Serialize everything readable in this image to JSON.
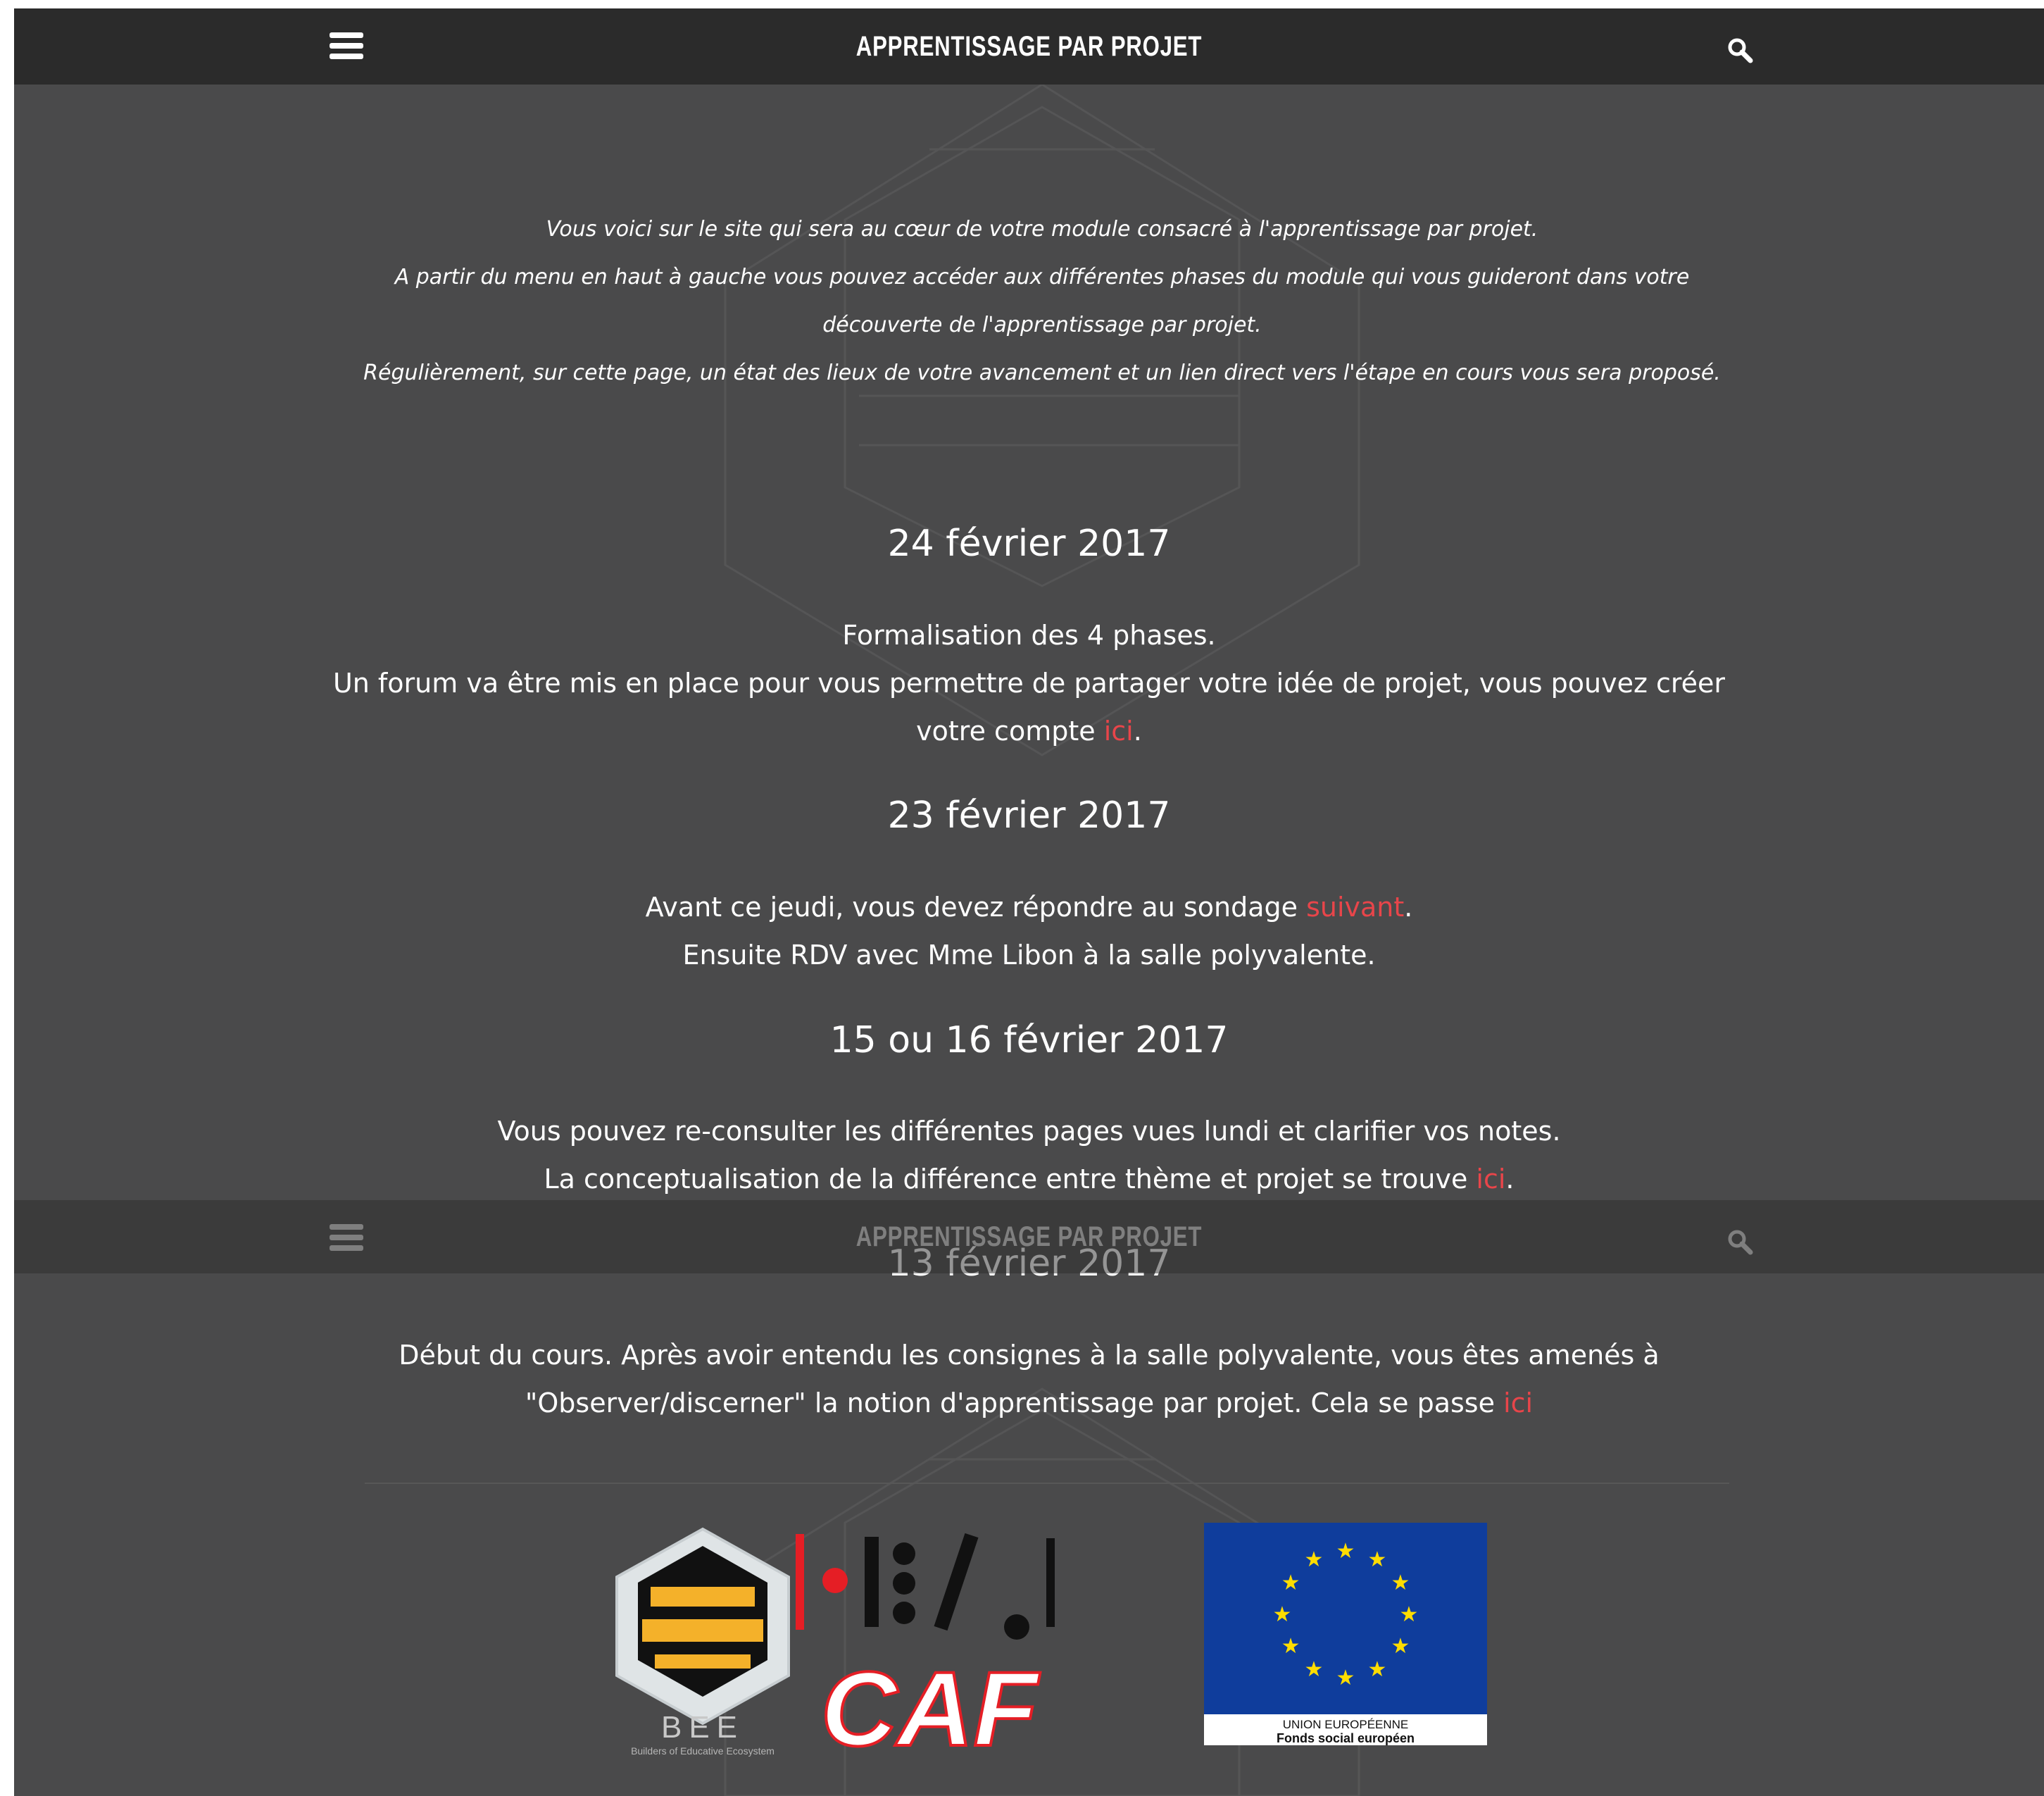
{
  "header": {
    "title": "APPRENTISSAGE PAR PROJET"
  },
  "intro": {
    "line1": "Vous voici sur le site qui sera au cœur de votre module consacré à l'apprentissage par projet.",
    "line2": "A partir du menu en haut à gauche vous pouvez accéder aux différentes phases du module qui vous guideront dans votre découverte de l'apprentissage par projet.",
    "line3": "Régulièrement, sur cette page, un état des lieux de votre avancement et un lien direct vers l'étape en cours vous sera proposé."
  },
  "updates": [
    {
      "date": "24 février 2017",
      "line1": "Formalisation des 4 phases.",
      "line2_text": "Un forum va être mis en place pour vous permettre de partager votre idée de projet, vous pouvez créer votre compte ",
      "link": "ici",
      "after": "."
    },
    {
      "date": "23 février 2017",
      "line1_text": "Avant ce jeudi, vous devez répondre au sondage ",
      "link": "suivant",
      "after": ".",
      "line2": "Ensuite RDV avec Mme Libon à la salle polyvalente."
    },
    {
      "date": "15 ou 16 février 2017",
      "line1": "Vous pouvez re-consulter les différentes pages vues lundi et clarifier vos notes.",
      "line2_text": "La conceptualisation de la différence entre thème et projet se trouve ",
      "link": "ici",
      "after": "."
    },
    {
      "date": "13 février 2017",
      "line1_text": "Début du cours. Après avoir entendu les consignes à la salle polyvalente, vous êtes amenés à \"Observer/discerner\" la notion d'apprentissage par projet. Cela se passe ",
      "link": "ici"
    }
  ],
  "logos": {
    "bee": {
      "title": "BEE",
      "subtitle": "Builders of Educative Ecosystem"
    },
    "caf": {
      "text": "CAF"
    },
    "eu": {
      "line1": "UNION EUROPÉENNE",
      "line2": "Fonds social européen"
    }
  },
  "colors": {
    "background": "#4a4a4b",
    "navbar": "#2b2b2b",
    "link": "#e8454a",
    "eu_blue": "#0f3d9c",
    "eu_star": "#ffdd00"
  }
}
